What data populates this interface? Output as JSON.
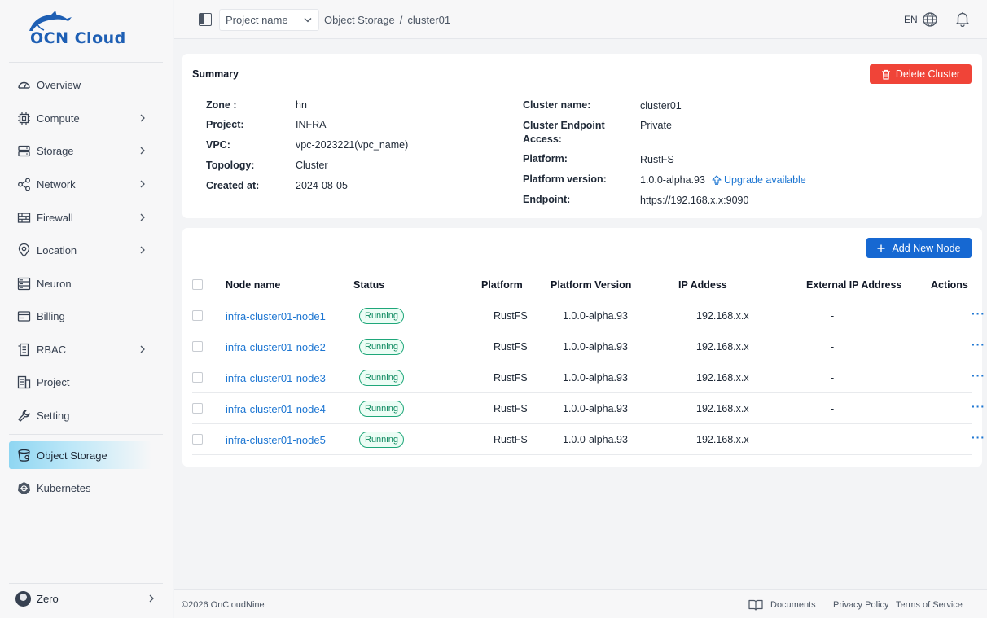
{
  "brand": {
    "name": "OCN Cloud",
    "color": "#1e5fb4"
  },
  "sidebar": {
    "items": [
      {
        "label": "Overview",
        "icon": "dashboard-icon",
        "has_children": false
      },
      {
        "label": "Compute",
        "icon": "cpu-icon",
        "has_children": true
      },
      {
        "label": "Storage",
        "icon": "storage-icon",
        "has_children": true
      },
      {
        "label": "Network",
        "icon": "share-icon",
        "has_children": true
      },
      {
        "label": "Firewall",
        "icon": "firewall-icon",
        "has_children": true
      },
      {
        "label": "Location",
        "icon": "location-pin-icon",
        "has_children": true
      },
      {
        "label": "Neuron",
        "icon": "server-icon",
        "has_children": false
      },
      {
        "label": "Billing",
        "icon": "billing-icon",
        "has_children": false
      },
      {
        "label": "RBAC",
        "icon": "document-list-icon",
        "has_children": true
      },
      {
        "label": "Project",
        "icon": "project-icon",
        "has_children": false
      },
      {
        "label": "Setting",
        "icon": "wrench-icon",
        "has_children": false
      },
      {
        "label": "Object Storage",
        "icon": "bucket-icon",
        "has_children": false,
        "active": true
      },
      {
        "label": "Kubernetes",
        "icon": "kubernetes-icon",
        "has_children": false
      }
    ],
    "user": {
      "name": "Zero"
    }
  },
  "topbar": {
    "project_placeholder": "Project name",
    "breadcrumb": [
      "Object Storage",
      "/",
      "cluster01"
    ],
    "language": "EN"
  },
  "summary": {
    "title": "Summary",
    "delete_label": "Delete Cluster",
    "left": [
      {
        "label": "Zone :",
        "value": "hn"
      },
      {
        "label": "Project:",
        "value": "INFRA"
      },
      {
        "label": "VPC:",
        "value": "vpc-2023221(vpc_name)"
      },
      {
        "label": "Topology:",
        "value": "Cluster"
      },
      {
        "label": "Created at:",
        "value": "2024-08-05"
      }
    ],
    "right": [
      {
        "label": "Cluster name:",
        "value": "cluster01"
      },
      {
        "label_line1": "Cluster Endpoint",
        "label_line2": "Access:",
        "value": "Private"
      },
      {
        "label": "Platform:",
        "value": "RustFS"
      },
      {
        "label": "Platform version:",
        "value": "1.0.0-alpha.93"
      },
      {
        "label": "Endpoint:",
        "value": "https://192.168.x.x:9090"
      }
    ],
    "upgrade_label": "Upgrade available"
  },
  "nodes": {
    "add_label": "Add New Node",
    "columns": [
      "Node name",
      "Status",
      "Platform",
      "Platform Version",
      "IP Addess",
      "External IP Address",
      "Actions"
    ],
    "rows": [
      {
        "name": "infra-cluster01-node1",
        "status": "Running",
        "platform": "RustFS",
        "version": "1.0.0-alpha.93",
        "ip": "192.168.x.x",
        "external_ip": "-",
        "action": "···"
      },
      {
        "name": "infra-cluster01-node2",
        "status": "Running",
        "platform": "RustFS",
        "version": "1.0.0-alpha.93",
        "ip": "192.168.x.x",
        "external_ip": "-",
        "action": "···"
      },
      {
        "name": "infra-cluster01-node3",
        "status": "Running",
        "platform": "RustFS",
        "version": "1.0.0-alpha.93",
        "ip": "192.168.x.x",
        "external_ip": "-",
        "action": "···"
      },
      {
        "name": "infra-cluster01-node4",
        "status": "Running",
        "platform": "RustFS",
        "version": "1.0.0-alpha.93",
        "ip": "192.168.x.x",
        "external_ip": "-",
        "action": "···"
      },
      {
        "name": "infra-cluster01-node5",
        "status": "Running",
        "platform": "RustFS",
        "version": "1.0.0-alpha.93",
        "ip": "192.168.x.x",
        "external_ip": "-",
        "action": "···"
      }
    ]
  },
  "footer": {
    "copyright": "©2026 OnCloudNine",
    "documents": "Documents",
    "privacy": "Privacy Policy",
    "terms": "Terms of Service"
  },
  "colors": {
    "danger": "#f04438",
    "primary": "#1668d2",
    "link": "#1d76d2",
    "success": "#1fa77a"
  }
}
